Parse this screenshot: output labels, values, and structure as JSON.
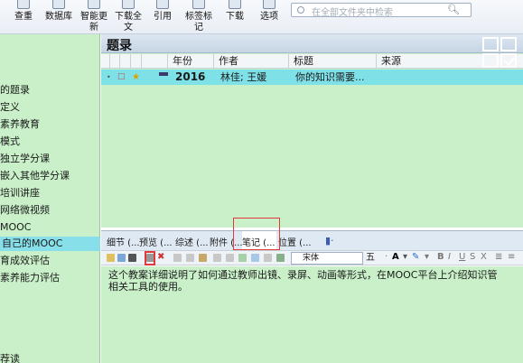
{
  "toolbar": {
    "buttons": [
      {
        "label": "查重",
        "label2": "",
        "icon": "search-duplicate-icon"
      },
      {
        "label": "数据库",
        "label2": "",
        "icon": "database-icon"
      },
      {
        "label": "智能更",
        "label2": "新",
        "icon": "smart-update-icon"
      },
      {
        "label": "下载全",
        "label2": "文",
        "icon": "download-fulltext-icon"
      },
      {
        "label": "引用",
        "label2": "",
        "icon": "cite-icon"
      },
      {
        "label": "标签标",
        "label2": "记",
        "icon": "tag-icon"
      },
      {
        "label": "下载",
        "label2": "",
        "icon": "download-icon"
      },
      {
        "label": "选项",
        "label2": "",
        "icon": "options-icon"
      }
    ],
    "search_placeholder": "在全部文件夹中检索"
  },
  "sidebar": {
    "items": [
      {
        "label": "的题录",
        "selected": false
      },
      {
        "label": "定义",
        "selected": false
      },
      {
        "label": "素养教育",
        "selected": false
      },
      {
        "label": "模式",
        "selected": false
      },
      {
        "label": "独立学分课",
        "selected": false
      },
      {
        "label": "嵌入其他学分课",
        "selected": false
      },
      {
        "label": "培训讲座",
        "selected": false
      },
      {
        "label": "网络微视频",
        "selected": false
      },
      {
        "label": "MOOC",
        "selected": false
      },
      {
        "label": "自己的MOOC",
        "selected": true
      },
      {
        "label": "育成效评估",
        "selected": false
      },
      {
        "label": "素养能力评估",
        "selected": false
      },
      {
        "label": "荐读",
        "selected": false
      }
    ]
  },
  "main": {
    "title": "题录",
    "columns": [
      "年份",
      "作者",
      "标题",
      "来源"
    ],
    "rows": [
      {
        "year": "2016",
        "authors": "林佳; 王媛",
        "title": "你的知识需要...",
        "source": ""
      }
    ]
  },
  "tabs": [
    {
      "label": "细节 (...",
      "active": false
    },
    {
      "label": "预览 (...",
      "active": false
    },
    {
      "label": "综述 (...",
      "active": false
    },
    {
      "label": "附件 (...",
      "active": false
    },
    {
      "label": "笔记 (...",
      "active": true
    },
    {
      "label": "位置 (...",
      "active": false
    }
  ],
  "editor": {
    "font": "宋体",
    "size": "五",
    "note_line1": "这个教案详细说明了如何通过教师出镜、录屏、动画等形式，在MOOC平台上介绍知识管",
    "note_line2": "相关工具的使用。"
  },
  "colors": {
    "panel_green": "#c9f0c9",
    "selected_cyan": "#86dfe9",
    "highlight_red": "#e23a3a"
  }
}
